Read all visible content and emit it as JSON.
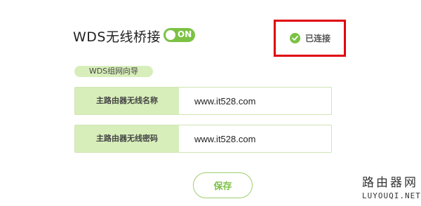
{
  "header": {
    "title": "WDS无线桥接",
    "toggle_label": "ON"
  },
  "status": {
    "icon": "check-circle-icon",
    "text": "已连接",
    "color": "#7bc143",
    "highlight_color": "#e0000f"
  },
  "guide": {
    "label": "WDS组网向导"
  },
  "form": {
    "ssid_label": "主路由器无线名称",
    "ssid_value": "www.it528.com",
    "password_label": "主路由器无线密码",
    "password_value": "www.it528.com"
  },
  "actions": {
    "save_label": "保存"
  },
  "watermark": {
    "cn": "路由器网",
    "en": "LUYOUQI.NET"
  },
  "colors": {
    "accent": "#7bc143",
    "label_bg": "#d7eeba"
  }
}
